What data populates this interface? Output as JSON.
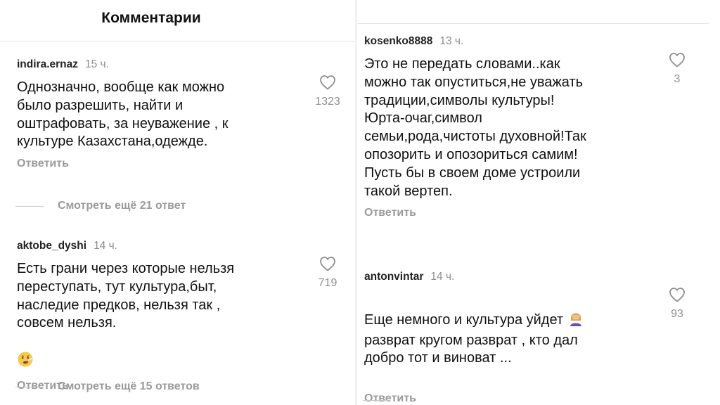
{
  "left": {
    "header_title": "Комментарии",
    "comments": [
      {
        "user": "indira.ernaz",
        "time": "15 ч.",
        "text": "Однозначно, вообще как можно\nбыло разрешить, найти и\nоштрафовать, за неуважение , к\nкультуре Казахстана,одежде.",
        "reply": "Ответить",
        "likes": "1323"
      },
      {
        "user": "aktobe_dyshi",
        "time": "14 ч.",
        "text": "Есть грани через которые нельзя\nпереступать, тут культура,быт,\nнаследие предков, нельзя так ,\nсовсем нельзя.",
        "emoji": "face-with-thermometer-emoji",
        "reply": "Ответить",
        "likes": "719"
      }
    ],
    "view_more": [
      "Смотреть ещё 21 ответ",
      "Смотреть ещё 15 ответов"
    ]
  },
  "right": {
    "comments": [
      {
        "user": "kosenko8888",
        "time": "13 ч.",
        "text": "Это не передать словами..как\nможно так опуститься,не уважать\nтрадиции,символы культуры!\nЮрта-очаг,символ\nсемьи,рода,чистоты духовной!Так\nопозорить и опозориться самим!\nПусть бы в своем доме устроили\nтакой вертеп.",
        "reply": "Ответить",
        "likes": "3"
      },
      {
        "user": "antonvintar",
        "time": "14 ч.",
        "text_line1": "Еще немного и культура уйдет",
        "emoji": "woman-facepalming-emoji",
        "text_rest": "разврат кругом разврат , кто дал\nдобро тот и виноват ...",
        "reply": "Ответить",
        "likes": "93"
      }
    ]
  },
  "icons": {
    "like": "heart-outline-icon"
  },
  "colors": {
    "muted": "#8e8e8e",
    "reply": "#9a9a9a",
    "text": "#111111"
  }
}
